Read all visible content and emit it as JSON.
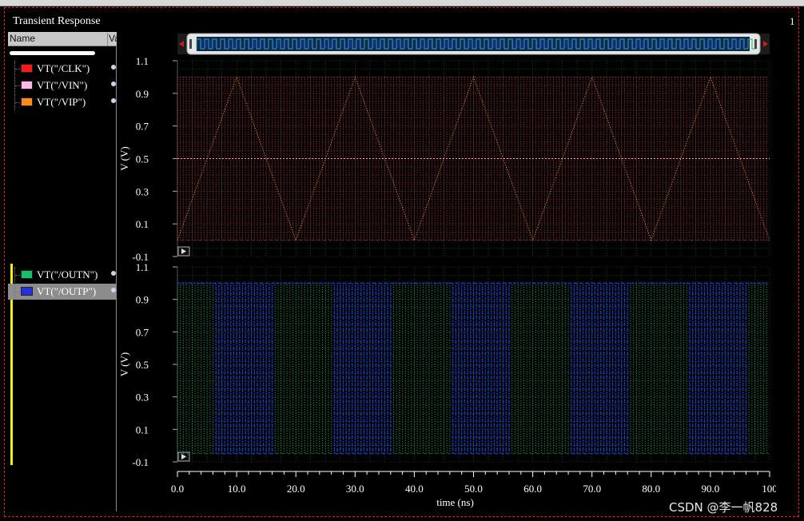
{
  "window": {
    "title": "Transient Response",
    "corner_label": "1"
  },
  "panel": {
    "columns": {
      "name": "Name",
      "value": "Va"
    },
    "group1": [
      {
        "label": "VT(\"/CLK\")",
        "color": "#ff1a1a"
      },
      {
        "label": "VT(\"/VIN\")",
        "color": "#ffb6e8"
      },
      {
        "label": "VT(\"/VIP\")",
        "color": "#ff8c1a"
      }
    ],
    "group2": [
      {
        "label": "VT(\"/OUTN\")",
        "color": "#19c06a",
        "selected": false
      },
      {
        "label": "VT(\"/OUTP\")",
        "color": "#2230e0",
        "selected": true
      }
    ]
  },
  "colors": {
    "grid": "#2c5c2c",
    "outn": "#1db86a",
    "outp": "#1a28ff",
    "clk": "#d84040",
    "vin": "#ff9ac8",
    "vip": "#ff9a30",
    "axis": "#ffffff"
  },
  "chart_data": [
    {
      "type": "line",
      "name": "top-strip",
      "ylabel": "V (V)",
      "ylim": [
        -0.1,
        1.1
      ],
      "yticks": [
        "1.1",
        "0.9",
        "0.7",
        "0.5",
        "0.3",
        "0.1",
        "-0.1"
      ],
      "series": [
        {
          "name": "VT(\"/CLK\")",
          "kind": "square",
          "low": 0.0,
          "high": 1.0,
          "period_ns": 1.0,
          "until_ns": 100
        },
        {
          "name": "VT(\"/VIN\")",
          "kind": "constant",
          "value": 0.5
        },
        {
          "name": "VT(\"/VIP\")",
          "kind": "points",
          "x": [
            0,
            10,
            20,
            30,
            40,
            50,
            60,
            70,
            80,
            90,
            100
          ],
          "y": [
            0.0,
            1.0,
            0.0,
            1.0,
            0.0,
            1.0,
            0.0,
            1.0,
            0.0,
            1.0,
            0.0
          ]
        }
      ]
    },
    {
      "type": "line",
      "name": "bottom-strip",
      "ylabel": "V (V)",
      "ylim": [
        -0.1,
        1.1
      ],
      "yticks": [
        "1.1",
        "0.9",
        "0.7",
        "0.5",
        "0.3",
        "0.1",
        "-0.1"
      ],
      "xlabel": "time (ns)",
      "xlim": [
        0,
        100
      ],
      "xticks": [
        "0.0",
        "10.0",
        "20.0",
        "30.0",
        "40.0",
        "50.0",
        "60.0",
        "70.0",
        "80.0",
        "90.0",
        "100"
      ],
      "series": [
        {
          "name": "VT(\"/OUTN\")",
          "kind": "square",
          "low": -0.05,
          "high": 1.0,
          "period_ns": 1.0,
          "until_ns": 100
        },
        {
          "name": "VT(\"/OUTP\")",
          "kind": "burst-square",
          "low": -0.05,
          "high": 1.0,
          "period_ns": 1.0,
          "bursts_ns": [
            [
              6,
              16
            ],
            [
              26,
              36
            ],
            [
              46,
              56
            ],
            [
              66,
              76
            ],
            [
              86,
              96
            ]
          ],
          "idle_value": 1.0
        }
      ]
    }
  ],
  "watermark": "CSDN @李一帆828"
}
